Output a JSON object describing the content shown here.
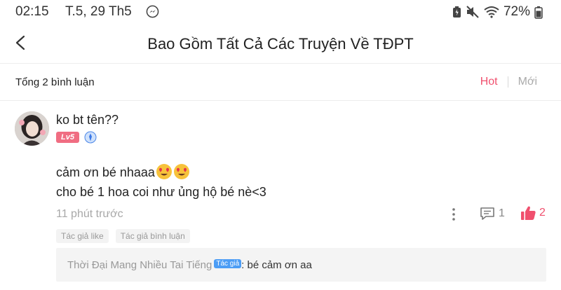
{
  "statusbar": {
    "time": "02:15",
    "date": "T.5, 29 Th5",
    "battery": "72%"
  },
  "header": {
    "title": "Bao Gồm Tất Cả Các Truyện Về TĐPT"
  },
  "comments_bar": {
    "total": "Tổng 2 bình luận",
    "sort_hot": "Hot",
    "sort_new": "Mới",
    "accent": "#f0506e"
  },
  "comment": {
    "username": "ko bt tên??",
    "level": "Lv5",
    "line1": "cảm ơn bé nhaaa",
    "line2": "cho bé 1 hoa coi như ủng hộ bé nè<3",
    "time": "11 phút trước",
    "replies": "1",
    "likes": "2",
    "tags": [
      "Tác giả like",
      "Tác giả bình luận"
    ],
    "reply": {
      "author": "Thời Đại Mang Nhiều Tai Tiếng",
      "badge": "Tác giả",
      "text": ": bé cảm ơn aa"
    }
  }
}
